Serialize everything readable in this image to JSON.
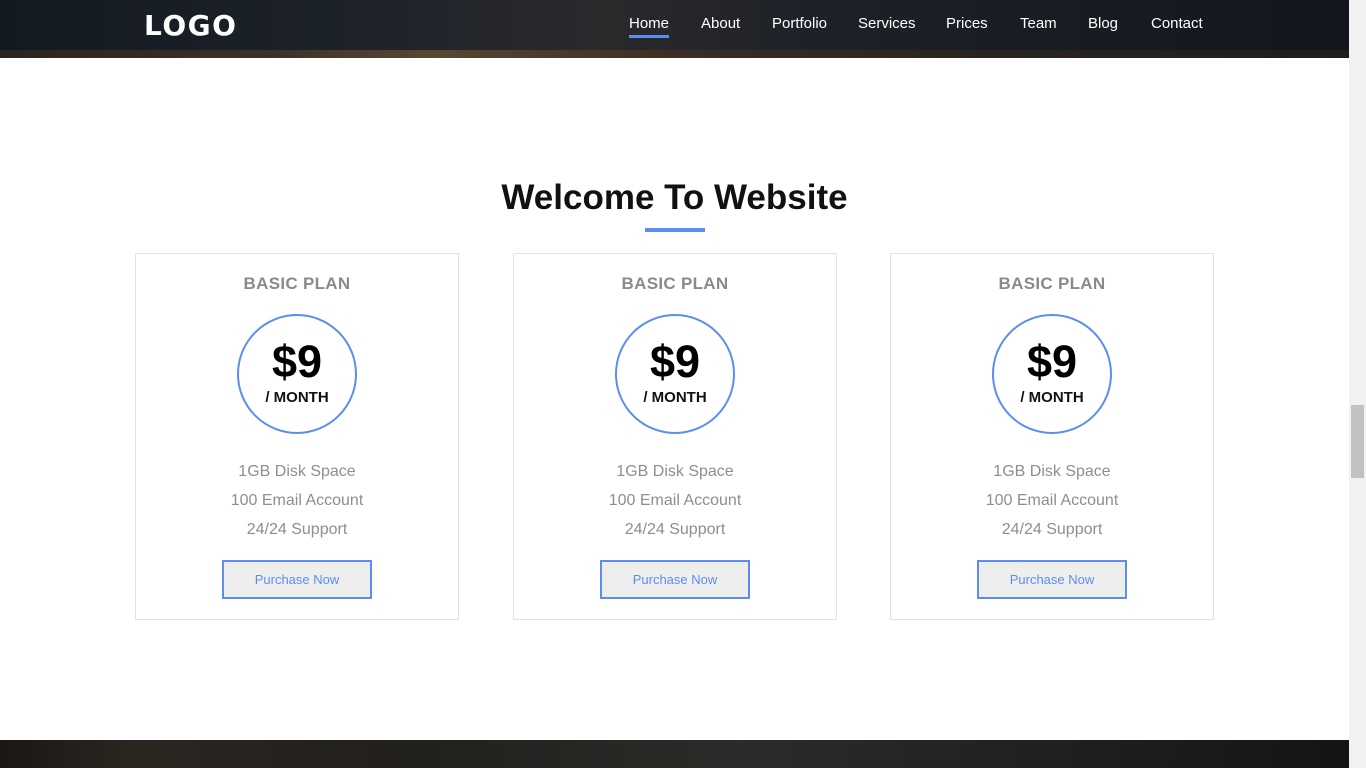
{
  "header": {
    "logo": "LOGO",
    "nav": [
      {
        "label": "Home",
        "active": true
      },
      {
        "label": "About"
      },
      {
        "label": "Portfolio"
      },
      {
        "label": "Services"
      },
      {
        "label": "Prices"
      },
      {
        "label": "Team"
      },
      {
        "label": "Blog"
      },
      {
        "label": "Contact"
      }
    ]
  },
  "section": {
    "title": "Welcome To Website"
  },
  "plans": [
    {
      "name": "BASIC PLAN",
      "price": "$9",
      "period": "/ MONTH",
      "features": [
        "1GB Disk Space",
        "100 Email Account",
        "24/24 Support"
      ],
      "button": "Purchase Now"
    },
    {
      "name": "BASIC PLAN",
      "price": "$9",
      "period": "/ MONTH",
      "features": [
        "1GB Disk Space",
        "100 Email Account",
        "24/24 Support"
      ],
      "button": "Purchase Now"
    },
    {
      "name": "BASIC PLAN",
      "price": "$9",
      "period": "/ MONTH",
      "features": [
        "1GB Disk Space",
        "100 Email Account",
        "24/24 Support"
      ],
      "button": "Purchase Now"
    }
  ],
  "colors": {
    "accent": "#5b8ef0",
    "muted_text": "#8e8e8e",
    "button_bg": "#eeeeee"
  }
}
